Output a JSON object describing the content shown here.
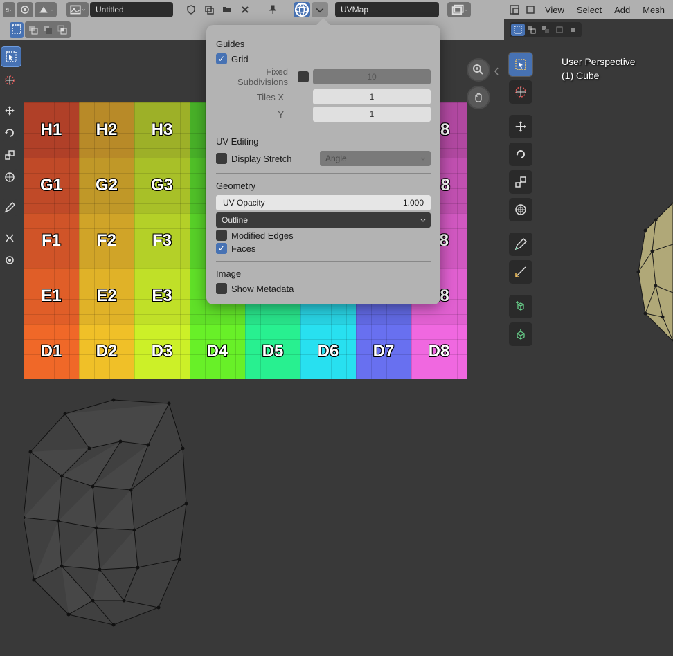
{
  "header": {
    "title_input": "Untitled",
    "uvmap_label": "UVMap",
    "menus": [
      "View",
      "Select",
      "Add",
      "Mesh"
    ]
  },
  "popover": {
    "guides_title": "Guides",
    "grid_label": "Grid",
    "fixed_subdiv_label": "Fixed Subdivisions",
    "fixed_subdiv_value": "10",
    "tiles_x_label": "Tiles X",
    "tiles_x_value": "1",
    "tiles_y_label": "Y",
    "tiles_y_value": "1",
    "uv_editing_title": "UV Editing",
    "display_stretch_label": "Display Stretch",
    "display_stretch_mode": "Angle",
    "geometry_title": "Geometry",
    "uv_opacity_label": "UV Opacity",
    "uv_opacity_value": "1.000",
    "outline_label": "Outline",
    "modified_edges_label": "Modified Edges",
    "faces_label": "Faces",
    "image_title": "Image",
    "show_metadata_label": "Show Metadata"
  },
  "viewport": {
    "perspective": "User Perspective",
    "object": "(1) Cube"
  },
  "uv_rows": [
    "H",
    "G",
    "F",
    "E",
    "D"
  ],
  "uv_cols": [
    1,
    2,
    3,
    4,
    5,
    6,
    7,
    8
  ],
  "uv_colors": {
    "H": [
      "#b04028",
      "#b88a28",
      "#9db028",
      "#48b028",
      "#28b070",
      "#28a0b0",
      "#4850b0",
      "#b048a0"
    ],
    "G": [
      "#c04a28",
      "#c09828",
      "#a8c028",
      "#50c028",
      "#28c078",
      "#28b0c0",
      "#5058c0",
      "#c050b0"
    ],
    "F": [
      "#d05428",
      "#d0a428",
      "#b4d028",
      "#58d028",
      "#28d080",
      "#28c0d0",
      "#5860d0",
      "#d058c0"
    ],
    "E": [
      "#e05e28",
      "#e0b228",
      "#c0e028",
      "#60e028",
      "#28e088",
      "#28d0e0",
      "#6068e0",
      "#e060d0"
    ],
    "D": [
      "#f06828",
      "#f0c028",
      "#ccf028",
      "#68f028",
      "#28f090",
      "#28e0f0",
      "#6870f0",
      "#f068e0"
    ]
  }
}
